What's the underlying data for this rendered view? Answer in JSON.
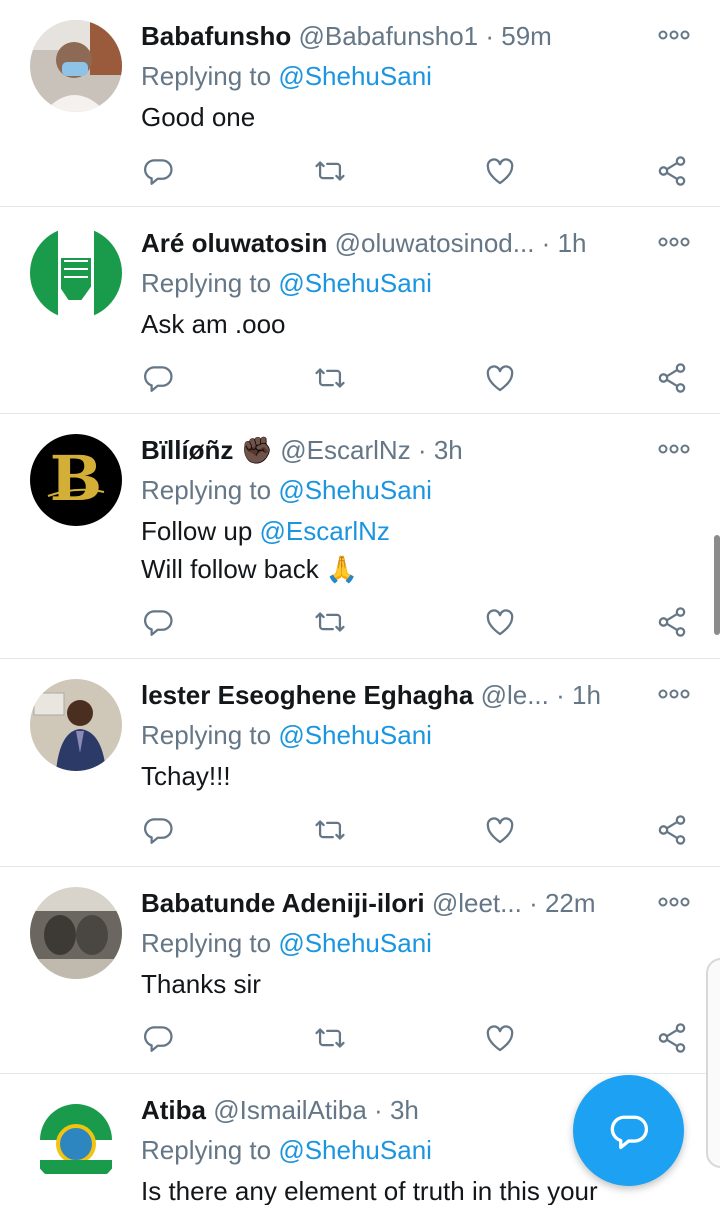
{
  "colors": {
    "accent": "#1da1f2",
    "mention": "#1b95e0",
    "muted": "#657786",
    "divider": "#e1e8ed"
  },
  "icons": {
    "reply": "reply-icon",
    "retweet": "retweet-icon",
    "like": "heart-icon",
    "share": "share-icon",
    "more": "more-icon",
    "compose": "compose-reply-icon"
  },
  "tweets": [
    {
      "name": "Babafunsho",
      "handle": "@Babafunsho1",
      "dot": "·",
      "time": "59m",
      "replying_label": "Replying to",
      "replying_to": "@ShehuSani",
      "text1": "Good one"
    },
    {
      "name": "Aré oluwatosin",
      "handle": "@oluwatosinod...",
      "dot": "·",
      "time": "1h",
      "replying_label": "Replying to",
      "replying_to": "@ShehuSani",
      "text1": "Ask am .ooo"
    },
    {
      "name": "Bïllíøñz",
      "emoji": "✊🏿",
      "handle": "@EscarlNz",
      "dot": "·",
      "time": "3h",
      "replying_label": "Replying to",
      "replying_to": "@ShehuSani",
      "text1": "Follow up ",
      "text1_mention": "@EscarlNz",
      "text2": "Will follow back 🙏"
    },
    {
      "name": "lester Eseoghene Eghagha",
      "handle": "@le...",
      "dot": "·",
      "time": "1h",
      "replying_label": "Replying to",
      "replying_to": "@ShehuSani",
      "text1": "Tchay!!!"
    },
    {
      "name": "Babatunde Adeniji-ilori",
      "handle": "@leet...",
      "dot": "·",
      "time": "22m",
      "replying_label": "Replying to",
      "replying_to": "@ShehuSani",
      "text1": "Thanks sir"
    },
    {
      "name": "Atiba",
      "handle": "@IsmailAtiba",
      "dot": "·",
      "time": "3h",
      "replying_label": "Replying to",
      "replying_to": "@ShehuSani",
      "text1": "Is there any element of truth in this your"
    }
  ]
}
